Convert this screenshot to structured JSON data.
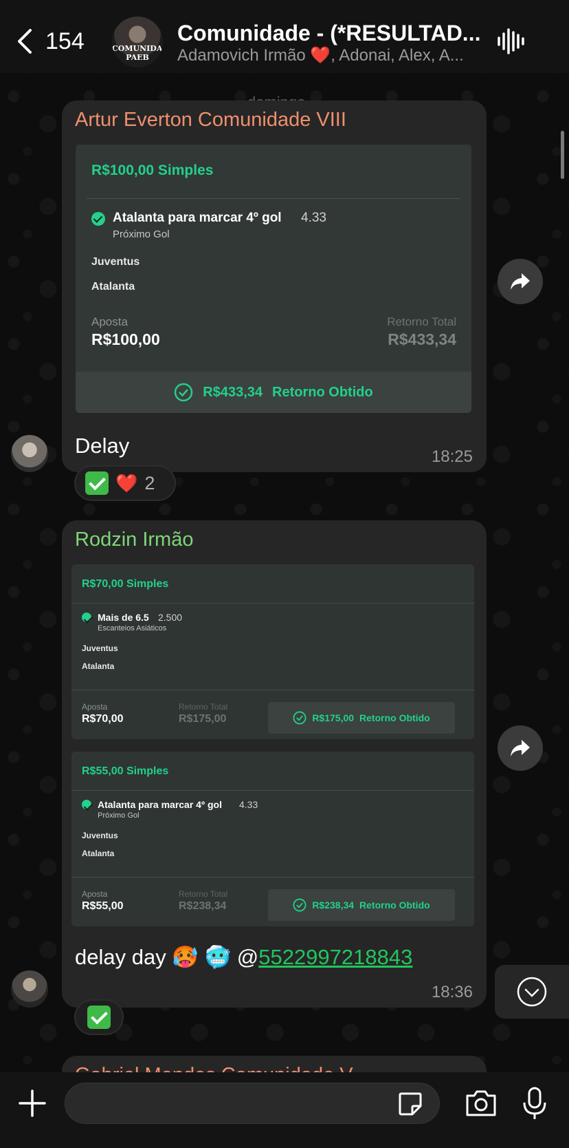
{
  "header": {
    "back_count": "154",
    "title": "Comunidade - (*RESULTAD...",
    "members": "Adamovich Irmão ❤️, Adonai, Alex, A...",
    "avatar_text": "COMUNIDADE PAEB"
  },
  "date_label": "domingo",
  "messages": [
    {
      "sender": "Artur Everton Comunidade VIII",
      "sender_color": "#f08f6e",
      "ticket": {
        "title": "R$100,00 Simples",
        "selection": "Atalanta para marcar 4º gol",
        "odds": "4.33",
        "market": "Próximo Gol",
        "team1": "Juventus",
        "team2": "Atalanta",
        "stake_label": "Aposta",
        "stake": "R$100,00",
        "return_label": "Retorno Total",
        "return": "R$433,34",
        "footer_amount": "R$433,34",
        "footer_label": "Retorno Obtido"
      },
      "text": "Delay",
      "time": "18:25",
      "reactions": {
        "heart": "❤️",
        "count": "2"
      }
    },
    {
      "sender": "Rodzin Irmão",
      "sender_color": "#7fd67a",
      "tickets": [
        {
          "title": "R$70,00 Simples",
          "selection": "Mais de 6.5",
          "odds": "2.500",
          "market": "Escanteios Asiáticos",
          "team1": "Juventus",
          "team2": "Atalanta",
          "stake_label": "Aposta",
          "stake": "R$70,00",
          "return_label": "Retorno Total",
          "return": "R$175,00",
          "footer_amount": "R$175,00",
          "footer_label": "Retorno Obtido"
        },
        {
          "title": "R$55,00 Simples",
          "selection": "Atalanta para marcar 4º gol",
          "odds": "4.33",
          "market": "Próximo Gol",
          "team1": "Juventus",
          "team2": "Atalanta",
          "stake_label": "Aposta",
          "stake": "R$55,00",
          "return_label": "Retorno Total",
          "return": "R$238,34",
          "footer_amount": "R$238,34",
          "footer_label": "Retorno Obtido"
        }
      ],
      "text_prefix": "delay day 🥵 🥶 @",
      "mention": "5522997218843",
      "time": "18:36"
    },
    {
      "sender": "Gabriel Mendes Comunidade V",
      "sender_color": "#f08f6e"
    }
  ],
  "colors": {
    "accent_green": "#22d18b",
    "bubble": "#262626",
    "ticket_bg": "#323836"
  },
  "icons": [
    "chevron-left-icon",
    "audio-wave-icon",
    "forward-icon",
    "plus-icon",
    "sticker-icon",
    "camera-icon",
    "microphone-icon",
    "chevron-down-icon"
  ]
}
